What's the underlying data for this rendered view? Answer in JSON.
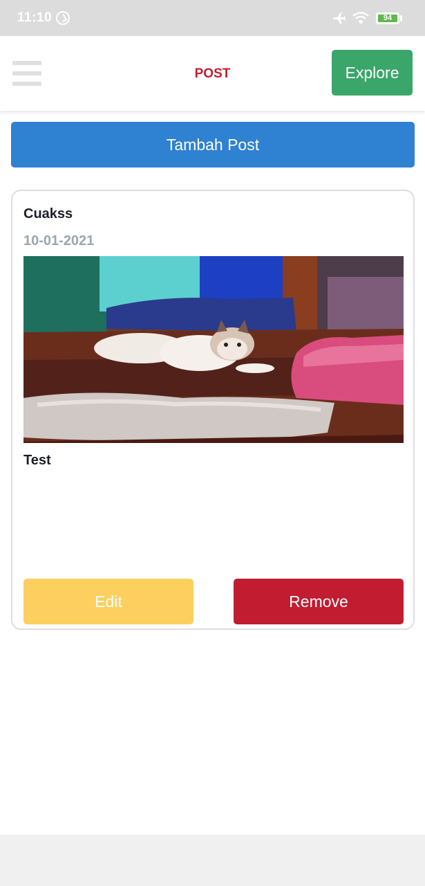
{
  "status_bar": {
    "time": "11:10",
    "battery": "94",
    "icons": [
      "do-not-disturb-icon",
      "airplane-icon",
      "wifi-icon",
      "battery-icon"
    ]
  },
  "header": {
    "menu_icon": "hamburger-menu-icon",
    "title": "POST",
    "explore_label": "Explore"
  },
  "actions": {
    "add_post_label": "Tambah Post"
  },
  "posts": [
    {
      "author": "Cuakss",
      "date": "10-01-2021",
      "caption": "Test",
      "edit_label": "Edit",
      "remove_label": "Remove"
    }
  ],
  "colors": {
    "title": "#c0212f",
    "explore": "#3aa66a",
    "add_post": "#2f81d1",
    "edit": "#fccf5f",
    "remove": "#c21c30",
    "date": "#9aa7b2"
  }
}
